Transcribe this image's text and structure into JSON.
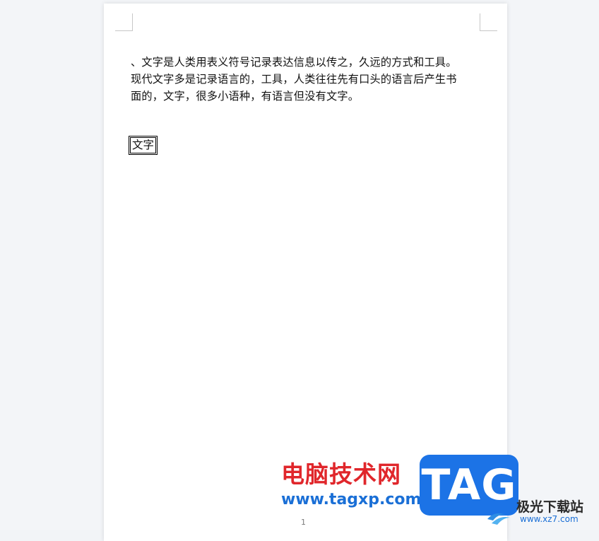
{
  "document": {
    "paragraphs": [
      "、文字是人类用表义符号记录表达信息以传之，久远的方式和工具。",
      "现代文字多是记录语言的，工具，人类往往先有口头的语言后产生书",
      "面的，文字，很多小语种，有语言但没有文字。"
    ],
    "boxed_text": "文字",
    "page_number": "1"
  },
  "watermark": {
    "site_name": "电脑技术网",
    "site_url": "www.tagxp.com",
    "badge_text": "TAG",
    "secondary_logo": "极光下载站",
    "secondary_url": "www.xz7.com"
  },
  "colors": {
    "background": "#f3f5f8",
    "page": "#ffffff",
    "watermark_red": "#e0262b",
    "watermark_blue": "#1a6fd6",
    "badge_blue": "#1c73e6"
  }
}
